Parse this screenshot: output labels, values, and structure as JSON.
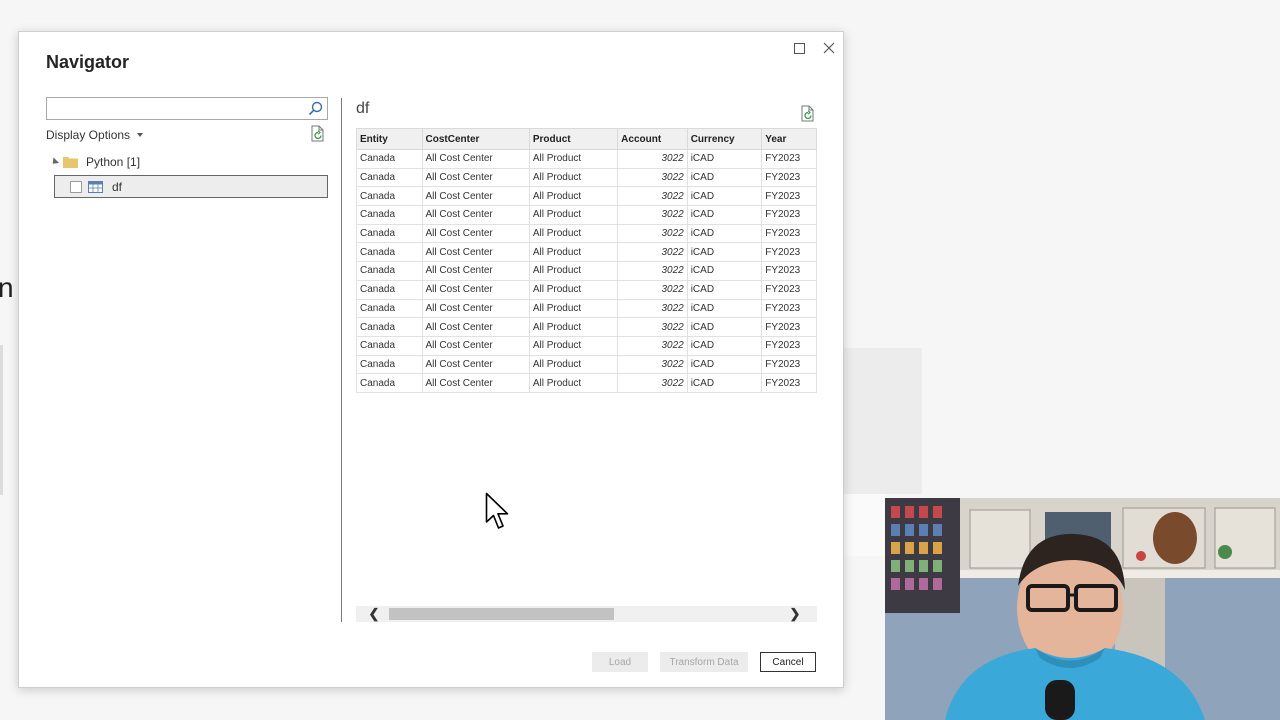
{
  "dialog": {
    "title": "Navigator",
    "search": {
      "value": "",
      "placeholder": ""
    },
    "display_options_label": "Display Options",
    "tree": {
      "folder_label": "Python [1]",
      "items": [
        {
          "label": "df",
          "checked": false,
          "selected": true
        }
      ]
    },
    "preview": {
      "title": "df",
      "columns": [
        "Entity",
        "CostCenter",
        "Product",
        "Account",
        "Currency",
        "Year"
      ],
      "rows": [
        [
          "Canada",
          "All Cost Center",
          "All Product",
          "3022",
          "iCAD",
          "FY2023"
        ],
        [
          "Canada",
          "All Cost Center",
          "All Product",
          "3022",
          "iCAD",
          "FY2023"
        ],
        [
          "Canada",
          "All Cost Center",
          "All Product",
          "3022",
          "iCAD",
          "FY2023"
        ],
        [
          "Canada",
          "All Cost Center",
          "All Product",
          "3022",
          "iCAD",
          "FY2023"
        ],
        [
          "Canada",
          "All Cost Center",
          "All Product",
          "3022",
          "iCAD",
          "FY2023"
        ],
        [
          "Canada",
          "All Cost Center",
          "All Product",
          "3022",
          "iCAD",
          "FY2023"
        ],
        [
          "Canada",
          "All Cost Center",
          "All Product",
          "3022",
          "iCAD",
          "FY2023"
        ],
        [
          "Canada",
          "All Cost Center",
          "All Product",
          "3022",
          "iCAD",
          "FY2023"
        ],
        [
          "Canada",
          "All Cost Center",
          "All Product",
          "3022",
          "iCAD",
          "FY2023"
        ],
        [
          "Canada",
          "All Cost Center",
          "All Product",
          "3022",
          "iCAD",
          "FY2023"
        ],
        [
          "Canada",
          "All Cost Center",
          "All Product",
          "3022",
          "iCAD",
          "FY2023"
        ],
        [
          "Canada",
          "All Cost Center",
          "All Product",
          "3022",
          "iCAD",
          "FY2023"
        ],
        [
          "Canada",
          "All Cost Center",
          "All Product",
          "3022",
          "iCAD",
          "FY2023"
        ]
      ]
    },
    "buttons": {
      "load": "Load",
      "transform": "Transform Data",
      "cancel": "Cancel"
    }
  },
  "background": {
    "partial_text": "n"
  },
  "colors": {
    "folder": "#e8c56f",
    "table_icon": "#5b7fb3",
    "disabled_text": "#a6a6a6"
  }
}
